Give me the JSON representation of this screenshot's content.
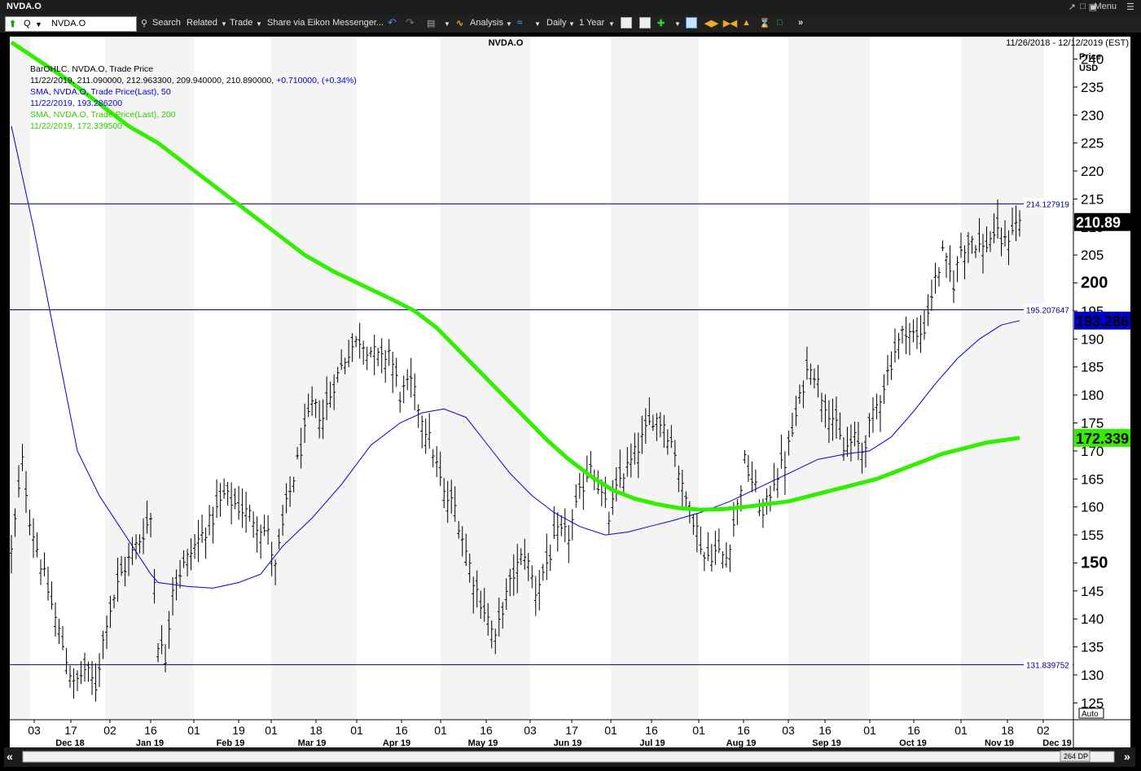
{
  "window": {
    "title": "NVDA.O",
    "menu_label": "Menu"
  },
  "toolbar": {
    "symbol_value": "NVDA.O",
    "quote_label": "Q",
    "search": "Search",
    "related": "Related",
    "trade": "Trade",
    "share": "Share via Eikon Messenger...",
    "analysis": "Analysis",
    "interval": "Daily",
    "range": "1 Year"
  },
  "chart": {
    "title": "NVDA.O",
    "date_range": "11/26/2018 - 12/12/2019 (EST)",
    "axis_title_1": "Price",
    "axis_title_2": "USD",
    "auto_label": "Auto",
    "dp_label": "264 DP",
    "legend": [
      {
        "text": "BarOHLC, NVDA.O, Trade Price",
        "color": "#000000"
      },
      {
        "text": "11/22/2019, 211.090000, 212.963300, 209.940000, 210.890000, +0.710000, (+0.34%)",
        "color": "#000000",
        "extra": "+0.710000, (+0.34%)",
        "extra_color": "#0000cc"
      },
      {
        "text": "SMA, NVDA.O, Trade Price(Last),  50",
        "color": "#0000cc"
      },
      {
        "text": "11/22/2019, 193.286200",
        "color": "#0000cc"
      },
      {
        "text": "SMA, NVDA.O, Trade Price(Last),  200",
        "color": "#33cc00"
      },
      {
        "text": "11/22/2019, 172.339500",
        "color": "#33cc00"
      }
    ],
    "colors": {
      "bars": "#000000",
      "sma50": "#0000cc",
      "sma200": "#33ee00",
      "hline": "#000080",
      "band": "#f4f4f4"
    }
  },
  "chart_data": {
    "type": "ohlc",
    "ylim": [
      122,
      244
    ],
    "y_ticks": [
      125,
      130,
      135,
      140,
      145,
      150,
      155,
      160,
      165,
      170,
      175,
      180,
      185,
      190,
      195,
      200,
      205,
      210,
      215,
      220,
      225,
      230,
      235,
      240
    ],
    "y_ticks_bold": [
      150,
      200
    ],
    "x_ticks": [
      "03",
      "17",
      "02",
      "16",
      "01",
      "19",
      "01",
      "18",
      "01",
      "16",
      "01",
      "16",
      "03",
      "17",
      "01",
      "16",
      "01",
      "16",
      "03",
      "16",
      "01",
      "16",
      "01",
      "18",
      "02"
    ],
    "x_months": [
      "Dec 18",
      "Jan 19",
      "Feb 19",
      "Mar 19",
      "Apr 19",
      "May 19",
      "Jun 19",
      "Jul 19",
      "Aug 19",
      "Sep 19",
      "Oct 19",
      "Nov 19",
      "Dec 19"
    ],
    "horizontal_lines": [
      {
        "label": "214.127919",
        "value": 214.127919
      },
      {
        "label": "195.207647",
        "value": 195.207647
      },
      {
        "label": "131.839752",
        "value": 131.839752
      }
    ],
    "last_values": [
      {
        "label": "210.89",
        "value": 210.89,
        "bg": "#000000",
        "fg": "#ffffff"
      },
      {
        "label": "193.286",
        "value": 193.286,
        "bg": "#0000cc",
        "fg": "#000000"
      },
      {
        "label": "172.339",
        "value": 172.339,
        "bg": "#33ee00",
        "fg": "#000000"
      }
    ],
    "price_path": [
      [
        0,
        152
      ],
      [
        3,
        168
      ],
      [
        5,
        158
      ],
      [
        8,
        150
      ],
      [
        12,
        140
      ],
      [
        15,
        133
      ],
      [
        17,
        128
      ],
      [
        20,
        131
      ],
      [
        23,
        128
      ],
      [
        26,
        140
      ],
      [
        30,
        148
      ],
      [
        34,
        153
      ],
      [
        38,
        158
      ],
      [
        40,
        136
      ],
      [
        42,
        133
      ],
      [
        44,
        146
      ],
      [
        50,
        153
      ],
      [
        55,
        158
      ],
      [
        58,
        162
      ],
      [
        62,
        160
      ],
      [
        66,
        158
      ],
      [
        70,
        155
      ],
      [
        72,
        149
      ],
      [
        75,
        160
      ],
      [
        78,
        168
      ],
      [
        82,
        178
      ],
      [
        85,
        176
      ],
      [
        88,
        182
      ],
      [
        92,
        188
      ],
      [
        95,
        190
      ],
      [
        98,
        188
      ],
      [
        101,
        186
      ],
      [
        103,
        188
      ],
      [
        106,
        180
      ],
      [
        109,
        182
      ],
      [
        112,
        176
      ],
      [
        115,
        170
      ],
      [
        118,
        162
      ],
      [
        121,
        160
      ],
      [
        124,
        152
      ],
      [
        127,
        145
      ],
      [
        130,
        140
      ],
      [
        132,
        136
      ],
      [
        134,
        142
      ],
      [
        137,
        148
      ],
      [
        140,
        152
      ],
      [
        143,
        145
      ],
      [
        146,
        150
      ],
      [
        149,
        155
      ],
      [
        152,
        155
      ],
      [
        155,
        162
      ],
      [
        158,
        168
      ],
      [
        161,
        162
      ],
      [
        163,
        158
      ],
      [
        166,
        165
      ],
      [
        169,
        168
      ],
      [
        172,
        172
      ],
      [
        175,
        176
      ],
      [
        178,
        175
      ],
      [
        181,
        170
      ],
      [
        183,
        163
      ],
      [
        185,
        160
      ],
      [
        187,
        156
      ],
      [
        189,
        151
      ],
      [
        192,
        152
      ],
      [
        195,
        151
      ],
      [
        198,
        160
      ],
      [
        200,
        168
      ],
      [
        203,
        163
      ],
      [
        205,
        158
      ],
      [
        208,
        165
      ],
      [
        211,
        168
      ],
      [
        214,
        176
      ],
      [
        216,
        182
      ],
      [
        218,
        186
      ],
      [
        221,
        180
      ],
      [
        224,
        176
      ],
      [
        227,
        170
      ],
      [
        230,
        172
      ],
      [
        232,
        170
      ],
      [
        235,
        176
      ],
      [
        238,
        182
      ],
      [
        241,
        188
      ],
      [
        244,
        192
      ],
      [
        247,
        190
      ],
      [
        249,
        192
      ],
      [
        251,
        198
      ],
      [
        254,
        205
      ],
      [
        257,
        200
      ],
      [
        259,
        206
      ],
      [
        262,
        208
      ],
      [
        265,
        206
      ],
      [
        268,
        209
      ],
      [
        271,
        207
      ],
      [
        273,
        210
      ],
      [
        275,
        211
      ]
    ],
    "sma50": [
      [
        0,
        228
      ],
      [
        6,
        210
      ],
      [
        12,
        190
      ],
      [
        18,
        170
      ],
      [
        24,
        162
      ],
      [
        32,
        154
      ],
      [
        38,
        148
      ],
      [
        40,
        146.5
      ],
      [
        48,
        145.8
      ],
      [
        55,
        145.5
      ],
      [
        62,
        146.5
      ],
      [
        68,
        148
      ],
      [
        74,
        153
      ],
      [
        82,
        158
      ],
      [
        90,
        164
      ],
      [
        98,
        171
      ],
      [
        106,
        175
      ],
      [
        112,
        176.8
      ],
      [
        118,
        177.5
      ],
      [
        124,
        176
      ],
      [
        130,
        171
      ],
      [
        136,
        166
      ],
      [
        142,
        162
      ],
      [
        148,
        159
      ],
      [
        155,
        156.5
      ],
      [
        162,
        155
      ],
      [
        168,
        155.5
      ],
      [
        174,
        156.5
      ],
      [
        180,
        157.5
      ],
      [
        188,
        159
      ],
      [
        196,
        161
      ],
      [
        204,
        163.5
      ],
      [
        212,
        166
      ],
      [
        220,
        168.5
      ],
      [
        228,
        169.5
      ],
      [
        234,
        170
      ],
      [
        240,
        172.5
      ],
      [
        246,
        177
      ],
      [
        252,
        182
      ],
      [
        258,
        186.5
      ],
      [
        264,
        190
      ],
      [
        270,
        192.5
      ],
      [
        275,
        193.286
      ]
    ],
    "sma200": [
      [
        0,
        243
      ],
      [
        8,
        239.5
      ],
      [
        16,
        236
      ],
      [
        24,
        232
      ],
      [
        32,
        228
      ],
      [
        40,
        225
      ],
      [
        48,
        221
      ],
      [
        56,
        217
      ],
      [
        64,
        213
      ],
      [
        72,
        209
      ],
      [
        80,
        205
      ],
      [
        88,
        202
      ],
      [
        96,
        199.5
      ],
      [
        104,
        197
      ],
      [
        110,
        195
      ],
      [
        116,
        192
      ],
      [
        122,
        188
      ],
      [
        128,
        184
      ],
      [
        134,
        180
      ],
      [
        140,
        176
      ],
      [
        146,
        172
      ],
      [
        152,
        168.5
      ],
      [
        158,
        165.5
      ],
      [
        164,
        163
      ],
      [
        170,
        161.5
      ],
      [
        176,
        160.5
      ],
      [
        182,
        159.8
      ],
      [
        188,
        159.5
      ],
      [
        194,
        159.6
      ],
      [
        200,
        160
      ],
      [
        206,
        160.5
      ],
      [
        212,
        161
      ],
      [
        218,
        162
      ],
      [
        224,
        163
      ],
      [
        230,
        164
      ],
      [
        236,
        165
      ],
      [
        242,
        166.5
      ],
      [
        248,
        168
      ],
      [
        254,
        169.5
      ],
      [
        260,
        170.5
      ],
      [
        266,
        171.5
      ],
      [
        275,
        172.3395
      ]
    ]
  }
}
